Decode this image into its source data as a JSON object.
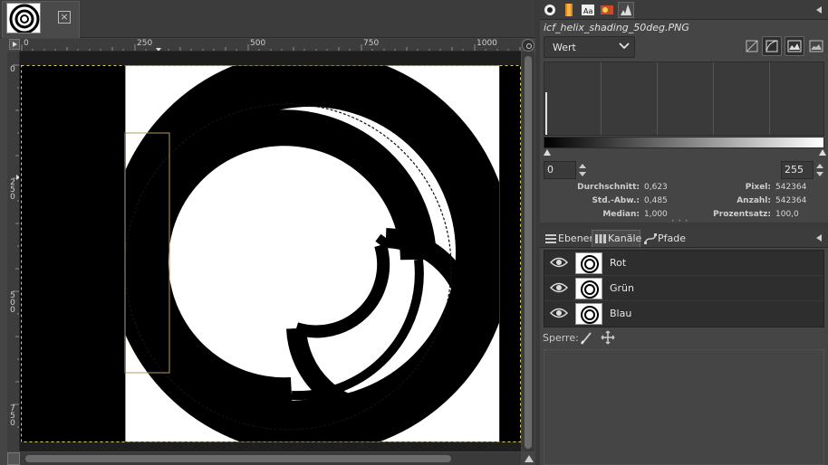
{
  "image_tab": {
    "thumbnail_icon": "spiral-image-thumbnail",
    "close_icon": "close-x-icon"
  },
  "rulers": {
    "horizontal_labels": [
      "0",
      "250",
      "500",
      "750",
      "1000"
    ],
    "vertical_labels": [
      "0",
      "250",
      "500",
      "750"
    ]
  },
  "histogram": {
    "tabs": [
      "histogram-tab",
      "palette-tab",
      "fonts-tab",
      "brushes-tab",
      "histogram-graph-tab"
    ],
    "title": "icf_helix_shading_50deg.PNG",
    "channel_select": "Wert",
    "range_min": "0",
    "range_max": "255",
    "stats_left": [
      {
        "label": "Durchschnitt:",
        "value": "0,623"
      },
      {
        "label": "Std.-Abw.:",
        "value": "0,485"
      },
      {
        "label": "Median:",
        "value": "1,000"
      }
    ],
    "stats_right": [
      {
        "label": "Pixel:",
        "value": "542364"
      },
      {
        "label": "Anzahl:",
        "value": "542364"
      },
      {
        "label": "Prozentsatz:",
        "value": "100,0"
      }
    ]
  },
  "dock2": {
    "tabs": [
      {
        "label": "Ebenen",
        "icon": "layers-icon"
      },
      {
        "label": "Kanäle",
        "icon": "channels-icon"
      },
      {
        "label": "Pfade",
        "icon": "paths-icon"
      }
    ],
    "channels": [
      {
        "name": "Rot"
      },
      {
        "name": "Grün"
      },
      {
        "name": "Blau"
      }
    ],
    "lock_label": "Sperre:"
  },
  "colors": {
    "background": "#454545",
    "panel_dark": "#2e2e2e",
    "text": "#d6d6d6",
    "image_black": "#000000",
    "image_white": "#ffffff"
  }
}
